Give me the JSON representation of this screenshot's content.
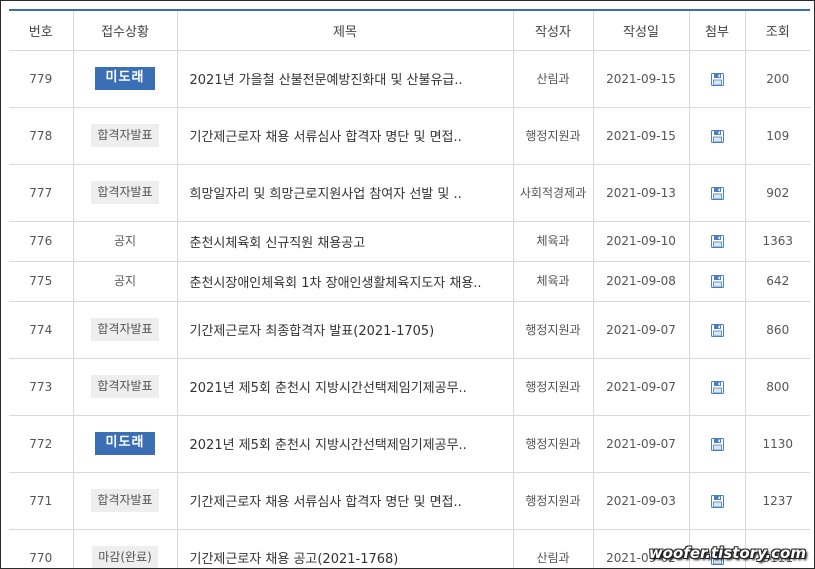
{
  "headers": {
    "no": "번호",
    "status": "접수상황",
    "title": "제목",
    "author": "작성자",
    "date": "작성일",
    "attach": "첨부",
    "views": "조회"
  },
  "rows": [
    {
      "no": "779",
      "status": "미도래",
      "status_type": "blue",
      "title": "2021년 가을철 산불전문예방진화대 및 산불유급..",
      "author": "산림과",
      "date": "2021-09-15",
      "attach_icon": "floppy-disk-icon",
      "views": "200"
    },
    {
      "no": "778",
      "status": "합격자발표",
      "status_type": "gray",
      "title": "기간제근로자 채용 서류심사 합격자 명단 및 면접..",
      "author": "행정지원과",
      "date": "2021-09-15",
      "attach_icon": "floppy-disk-icon",
      "views": "109"
    },
    {
      "no": "777",
      "status": "합격자발표",
      "status_type": "gray",
      "title": "희망일자리 및 희망근로지원사업 참여자 선발 및 ..",
      "author": "사회적경제과",
      "date": "2021-09-13",
      "attach_icon": "floppy-disk-icon",
      "views": "902"
    },
    {
      "no": "776",
      "status": "공지",
      "status_type": "plain",
      "title": "춘천시체육회 신규직원 채용공고",
      "author": "체육과",
      "date": "2021-09-10",
      "attach_icon": "floppy-disk-icon",
      "views": "1363"
    },
    {
      "no": "775",
      "status": "공지",
      "status_type": "plain",
      "title": "춘천시장애인체육회 1차 장애인생활체육지도자 채용..",
      "author": "체육과",
      "date": "2021-09-08",
      "attach_icon": "floppy-disk-icon",
      "views": "642"
    },
    {
      "no": "774",
      "status": "합격자발표",
      "status_type": "gray",
      "title": "기간제근로자 최종합격자 발표(2021-1705)",
      "author": "행정지원과",
      "date": "2021-09-07",
      "attach_icon": "floppy-disk-icon",
      "views": "860"
    },
    {
      "no": "773",
      "status": "합격자발표",
      "status_type": "gray",
      "title": "2021년 제5회 춘천시 지방시간선택제임기제공무..",
      "author": "행정지원과",
      "date": "2021-09-07",
      "attach_icon": "floppy-disk-icon",
      "views": "800"
    },
    {
      "no": "772",
      "status": "미도래",
      "status_type": "blue",
      "title": "2021년 제5회 춘천시 지방시간선택제임기제공무..",
      "author": "행정지원과",
      "date": "2021-09-07",
      "attach_icon": "floppy-disk-icon",
      "views": "1130"
    },
    {
      "no": "771",
      "status": "합격자발표",
      "status_type": "gray",
      "title": "기간제근로자 채용 서류심사 합격자 명단 및 면접..",
      "author": "행정지원과",
      "date": "2021-09-03",
      "attach_icon": "floppy-disk-icon",
      "views": "1237"
    },
    {
      "no": "770",
      "status": "마감(완료)",
      "status_type": "gray",
      "title": "기간제근로자 채용 공고(2021-1768)",
      "author": "산림과",
      "date": "2021-09-02",
      "attach_icon": "floppy-disk-icon",
      "views": "3111"
    }
  ],
  "colors": {
    "accent": "#3b6fb5",
    "header_rule": "#3a6fb6",
    "badge_gray": "#eeeeee",
    "icon": "#4a7fc1"
  },
  "watermark": "woofer.tistory.com"
}
